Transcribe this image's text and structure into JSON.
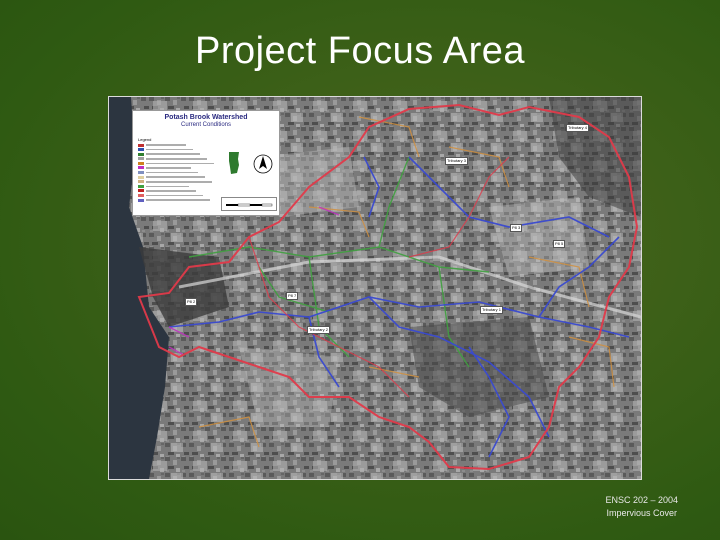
{
  "slide": {
    "title": "Project Focus Area"
  },
  "map": {
    "legend": {
      "title": "Potash Brook Watershed",
      "subtitle": "Current Conditions",
      "heading": "Legend",
      "item_colors": [
        "#c03030",
        "#3050b0",
        "#308030",
        "#a0a0a0",
        "#d08020",
        "#c030c0",
        "#8090c0",
        "#e0d0a0",
        "#d0b080",
        "#40a040",
        "#c02020",
        "#e06060",
        "#6060c0"
      ]
    },
    "labels": [
      "Tributary 4",
      "Tributary 3",
      "P8 3",
      "P8 5",
      "P8 7",
      "P8 2",
      "Tributary 1",
      "Tributary 2"
    ],
    "colors": {
      "watershed_boundary": "#e03a4a",
      "streams": "#3a4ad0",
      "roads": "#40a040",
      "development": "#c8a060"
    }
  },
  "footer": {
    "line1": "ENSC 202 – 2004",
    "line2": "Impervious Cover"
  }
}
